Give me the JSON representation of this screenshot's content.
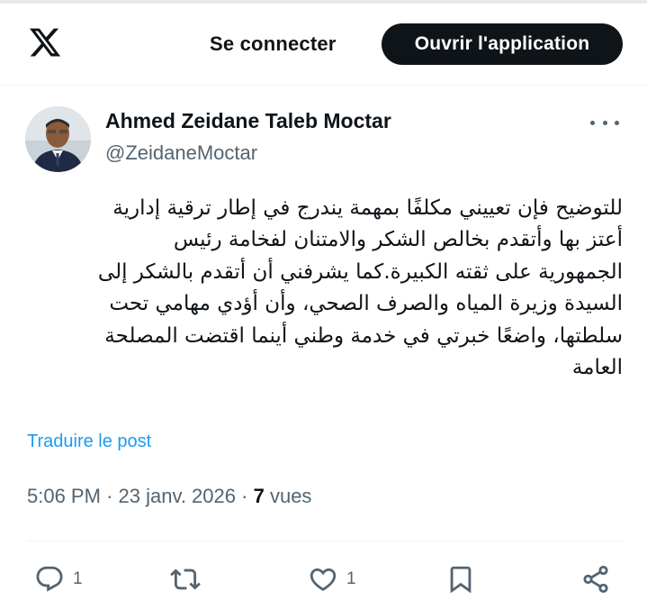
{
  "header": {
    "logo_icon": "x-logo-icon",
    "login_label": "Se connecter",
    "open_app_label": "Ouvrir l'application"
  },
  "author": {
    "name": "Ahmed Zeidane Taleb Moctar",
    "handle": "@ZeidaneMoctar",
    "avatar_icon": "avatar-photo"
  },
  "tweet": {
    "text": "للتوضيح فإن تعييني مكلفًا بمهمة يندرج في إطار ترقية إدارية\nأعتز بها وأتقدم بخالص الشكر والامتنان لفخامة رئيس\nالجمهورية على ثقته الكبيرة.كما يشرفني أن أتقدم بالشكر إلى\nالسيدة وزيرة المياه والصرف الصحي، وأن أؤدي مهامي تحت\nسلطتها، واضعًا خبرتي في خدمة وطني أينما اقتضت المصلحة\nالعامة",
    "translate_label": "Traduire le post",
    "time": "5:06 PM",
    "date": "23 janv. 2026",
    "separator": "·",
    "views_count": "7",
    "views_label": "vues"
  },
  "actions": {
    "reply_count": "1",
    "repost_count": "",
    "like_count": "1"
  },
  "colors": {
    "text": "#0f1419",
    "secondary": "#536471",
    "link": "#1d9bf0",
    "button_bg": "#0f1419"
  }
}
